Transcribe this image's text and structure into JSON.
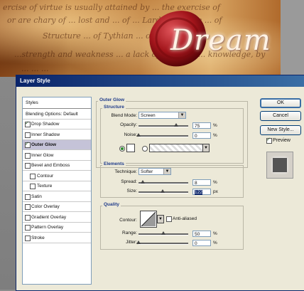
{
  "canvas": {
    "logo_text": "Dream",
    "script_lines": [
      "ercise of virtue is usually attained by ... the exercise of",
      "or are chary of ... lost and ... of ... Lardiner ... the ... of",
      "Structure ... of Tythian ... of a ... ",
      "...strength and weakness ... a lack of strength ... knowledge, by",
      "... ... ..."
    ]
  },
  "dialog": {
    "title": "Layer Style",
    "styles_header": "Styles",
    "blending_options": "Blending Options: Default",
    "style_items": [
      {
        "label": "Drop Shadow",
        "checked": true,
        "selected": false,
        "indent": false
      },
      {
        "label": "Inner Shadow",
        "checked": false,
        "selected": false,
        "indent": false
      },
      {
        "label": "Outer Glow",
        "checked": true,
        "selected": true,
        "indent": false
      },
      {
        "label": "Inner Glow",
        "checked": false,
        "selected": false,
        "indent": false
      },
      {
        "label": "Bevel and Emboss",
        "checked": false,
        "selected": false,
        "indent": false
      },
      {
        "label": "Contour",
        "checked": false,
        "selected": false,
        "indent": true
      },
      {
        "label": "Texture",
        "checked": false,
        "selected": false,
        "indent": true
      },
      {
        "label": "Satin",
        "checked": false,
        "selected": false,
        "indent": false
      },
      {
        "label": "Color Overlay",
        "checked": false,
        "selected": false,
        "indent": false
      },
      {
        "label": "Gradient Overlay",
        "checked": false,
        "selected": false,
        "indent": false
      },
      {
        "label": "Pattern Overlay",
        "checked": false,
        "selected": false,
        "indent": false
      },
      {
        "label": "Stroke",
        "checked": false,
        "selected": false,
        "indent": false
      }
    ],
    "outer_glow": {
      "title": "Outer Glow",
      "structure": {
        "title": "Structure",
        "blend_mode_label": "Blend Mode:",
        "blend_mode_value": "Screen",
        "opacity_label": "Opacity:",
        "opacity_value": "75",
        "opacity_level": 0.75,
        "noise_label": "Noise:",
        "noise_value": "0",
        "noise_level": 0,
        "percent": "%",
        "color_radio_selected": true
      },
      "elements": {
        "title": "Elements",
        "technique_label": "Technique:",
        "technique_value": "Softer",
        "spread_label": "Spread:",
        "spread_value": "8",
        "spread_level": 0.08,
        "size_label": "Size:",
        "size_value": "122",
        "size_level": 0.49,
        "percent": "%",
        "px": "px"
      },
      "quality": {
        "title": "Quality",
        "contour_label": "Contour:",
        "anti_aliased_label": "Anti-aliased",
        "range_label": "Range:",
        "range_value": "50",
        "range_level": 0.5,
        "jitter_label": "Jitter:",
        "jitter_value": "0",
        "jitter_level": 0,
        "percent": "%"
      }
    },
    "buttons": {
      "ok": "OK",
      "cancel": "Cancel",
      "new_style": "New Style...",
      "preview_label": "Preview",
      "preview_checked": true
    }
  }
}
